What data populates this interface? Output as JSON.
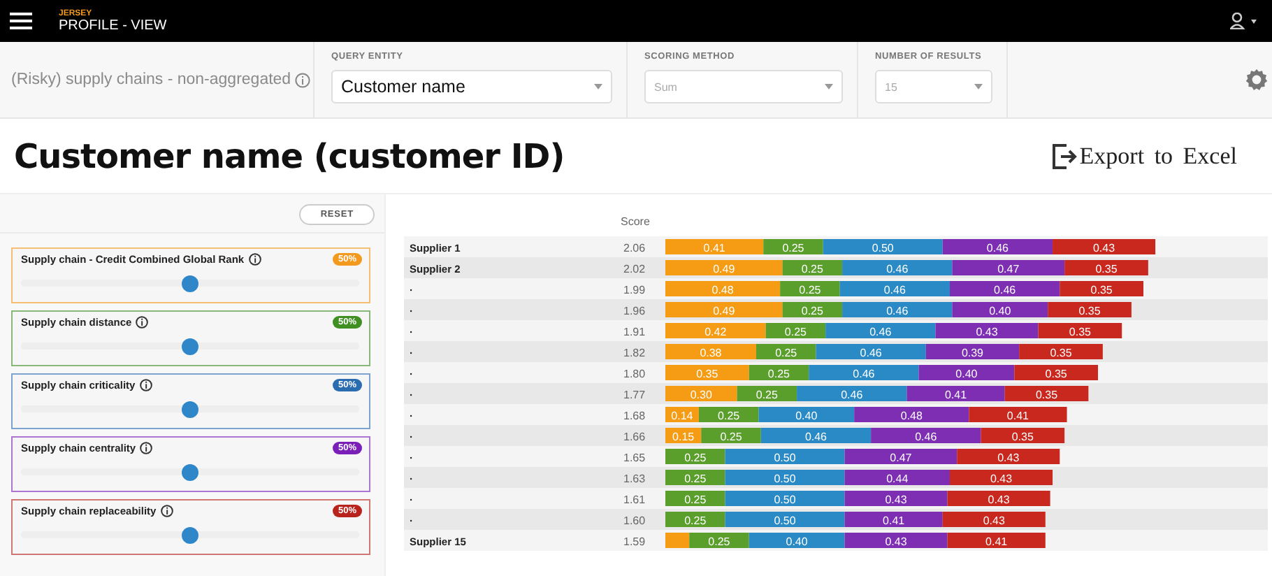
{
  "header": {
    "brand": "JERSEY",
    "title": "PROFILE - VIEW"
  },
  "filters": {
    "description": "(Risky) supply chains - non-aggregated",
    "fields": [
      {
        "label": "QUERY ENTITY",
        "value": "Customer name",
        "disabled": false
      },
      {
        "label": "SCORING METHOD",
        "value": "Sum",
        "disabled": true
      },
      {
        "label": "NUMBER OF RESULTS",
        "value": "15",
        "disabled": true
      }
    ]
  },
  "page_title": "Customer name (customer ID)",
  "export_button": "Export to Excel",
  "reset_button": "RESET",
  "weights": [
    {
      "name": "Supply chain - Credit Combined Global Rank",
      "badge": "50%",
      "level": 0.5,
      "color": "#f39a1e"
    },
    {
      "name": "Supply chain distance",
      "badge": "50%",
      "level": 0.5,
      "color": "#3f8f22"
    },
    {
      "name": "Supply chain criticality",
      "badge": "50%",
      "level": 0.5,
      "color": "#2a6cb0"
    },
    {
      "name": "Supply chain centrality",
      "badge": "50%",
      "level": 0.5,
      "color": "#7a1fb8"
    },
    {
      "name": "Supply chain replaceability",
      "badge": "50%",
      "level": 0.5,
      "color": "#b8231c"
    }
  ],
  "results": {
    "score_header": "Score",
    "scores": [
      "2.06",
      "2.02",
      "1.99",
      "1.96",
      "1.91",
      "1.82",
      "1.80",
      "1.77",
      "1.68",
      "1.66",
      "1.65",
      "1.63",
      "1.61",
      "1.60",
      "1.59"
    ],
    "chart_data": {
      "type": "bar",
      "orientation": "horizontal",
      "stacked": true,
      "categories": [
        "Supplier 1",
        "Supplier 2",
        "·",
        "·",
        "·",
        "·",
        "·",
        "·",
        "·",
        "·",
        "·",
        "·",
        "·",
        "·",
        "Supplier 15"
      ],
      "series": [
        {
          "color": "#f59c14",
          "values": [
            0.41,
            0.49,
            0.48,
            0.49,
            0.42,
            0.38,
            0.35,
            0.3,
            0.14,
            0.15,
            null,
            null,
            null,
            null,
            0.1
          ],
          "value_labels": [
            "0.41",
            "0.49",
            "0.48",
            "0.49",
            "0.42",
            "0.38",
            "0.35",
            "0.30",
            "0.14",
            "0.15",
            null,
            null,
            null,
            null,
            null
          ]
        },
        {
          "color": "#5a9e2c",
          "values": [
            0.25,
            0.25,
            0.25,
            0.25,
            0.25,
            0.25,
            0.25,
            0.25,
            0.25,
            0.25,
            0.25,
            0.25,
            0.25,
            0.25,
            0.25
          ],
          "value_labels": [
            "0.25",
            "0.25",
            "0.25",
            "0.25",
            "0.25",
            "0.25",
            "0.25",
            "0.25",
            "0.25",
            "0.25",
            "0.25",
            "0.25",
            "0.25",
            "0.25",
            "0.25"
          ]
        },
        {
          "color": "#2a8ac6",
          "values": [
            0.5,
            0.46,
            0.46,
            0.46,
            0.46,
            0.46,
            0.46,
            0.46,
            0.4,
            0.46,
            0.5,
            0.5,
            0.5,
            0.5,
            0.4
          ],
          "value_labels": [
            "0.50",
            "0.46",
            "0.46",
            "0.46",
            "0.46",
            "0.46",
            "0.46",
            "0.46",
            "0.40",
            "0.46",
            "0.50",
            "0.50",
            "0.50",
            "0.50",
            "0.40"
          ]
        },
        {
          "color": "#7d2eb2",
          "values": [
            0.46,
            0.47,
            0.46,
            0.4,
            0.43,
            0.39,
            0.4,
            0.41,
            0.48,
            0.46,
            0.47,
            0.44,
            0.43,
            0.41,
            0.43
          ],
          "value_labels": [
            "0.46",
            "0.47",
            "0.46",
            "0.40",
            "0.43",
            "0.39",
            "0.40",
            "0.41",
            "0.48",
            "0.46",
            "0.47",
            "0.44",
            "0.43",
            "0.41",
            "0.43"
          ]
        },
        {
          "color": "#c9281f",
          "values": [
            0.43,
            0.35,
            0.35,
            0.35,
            0.35,
            0.35,
            0.35,
            0.35,
            0.41,
            0.35,
            0.43,
            0.43,
            0.43,
            0.43,
            0.41
          ],
          "value_labels": [
            "0.43",
            "0.35",
            "0.35",
            "0.35",
            "0.35",
            "0.35",
            "0.35",
            "0.35",
            "0.41",
            "0.35",
            "0.43",
            "0.43",
            "0.43",
            "0.43",
            "0.41"
          ]
        }
      ]
    }
  }
}
